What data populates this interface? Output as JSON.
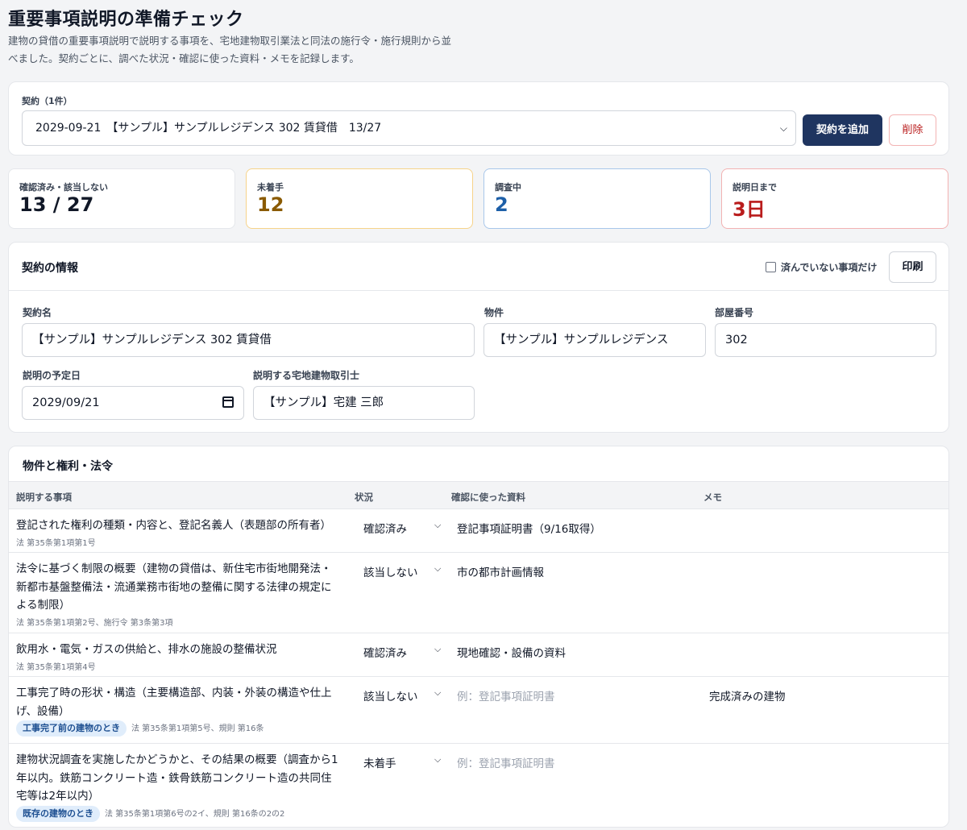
{
  "header": {
    "title": "重要事項説明の準備チェック",
    "subtitle": "建物の貸借の重要事項説明で説明する事項を、宅地建物取引業法と同法の施行令・施行規則から並べました。契約ごとに、調べた状況・確認に使った資料・メモを記録します。"
  },
  "contract_selector": {
    "label": "契約（1件）",
    "selected": "2029-09-21　【サンプル】サンプルレジデンス 302 賃貸借　13/27",
    "add_label": "契約を追加",
    "delete_label": "削除"
  },
  "stats": [
    {
      "label": "確認済み・該当しない",
      "value": "13 / 27"
    },
    {
      "label": "未着手",
      "value": "12"
    },
    {
      "label": "調査中",
      "value": "2"
    },
    {
      "label": "説明日まで",
      "value": "3日"
    }
  ],
  "info": {
    "heading": "契約の情報",
    "filter_label": "済んでいない事項だけ",
    "print_label": "印刷",
    "fields": {
      "contract_name": {
        "label": "契約名",
        "value": "【サンプル】サンプルレジデンス 302 賃貸借"
      },
      "property": {
        "label": "物件",
        "value": "【サンプル】サンプルレジデンス"
      },
      "room": {
        "label": "部屋番号",
        "value": "302"
      },
      "date": {
        "label": "説明の予定日",
        "value": "2029/09/21"
      },
      "agent": {
        "label": "説明する宅地建物取引士",
        "value": "【サンプル】宅建 三郎"
      }
    }
  },
  "section": {
    "heading": "物件と権利・法令",
    "columns": [
      "説明する事項",
      "状況",
      "確認に使った資料",
      "メモ"
    ],
    "rows": [
      {
        "title": "登記された権利の種類・内容と、登記名義人（表題部の所有者）",
        "tag": "",
        "ref": "法 第35条第1項第1号",
        "status": "確認済み",
        "resource": "登記事項証明書（9/16取得）",
        "resource_placeholder": "",
        "memo": ""
      },
      {
        "title": "法令に基づく制限の概要（建物の貸借は、新住宅市街地開発法・新都市基盤整備法・流通業務市街地の整備に関する法律の規定による制限）",
        "tag": "",
        "ref": "法 第35条第1項第2号、施行令 第3条第3項",
        "status": "該当しない",
        "resource": "市の都市計画情報",
        "resource_placeholder": "",
        "memo": ""
      },
      {
        "title": "飲用水・電気・ガスの供給と、排水の施設の整備状況",
        "tag": "",
        "ref": "法 第35条第1項第4号",
        "status": "確認済み",
        "resource": "現地確認・設備の資料",
        "resource_placeholder": "",
        "memo": ""
      },
      {
        "title": "工事完了時の形状・構造（主要構造部、内装・外装の構造や仕上げ、設備）",
        "tag": "工事完了前の建物のとき",
        "ref": "法 第35条第1項第5号、規則 第16条",
        "status": "該当しない",
        "resource": "",
        "resource_placeholder": "例：登記事項証明書",
        "memo": "完成済みの建物"
      },
      {
        "title": "建物状況調査を実施したかどうかと、その結果の概要（調査から1年以内。鉄筋コンクリート造・鉄骨鉄筋コンクリート造の共同住宅等は2年以内）",
        "tag": "既存の建物のとき",
        "ref": "法 第35条第1項第6号の2イ、規則 第16条の2の2",
        "status": "未着手",
        "resource": "",
        "resource_placeholder": "例：登記事項証明書",
        "memo": ""
      }
    ]
  }
}
